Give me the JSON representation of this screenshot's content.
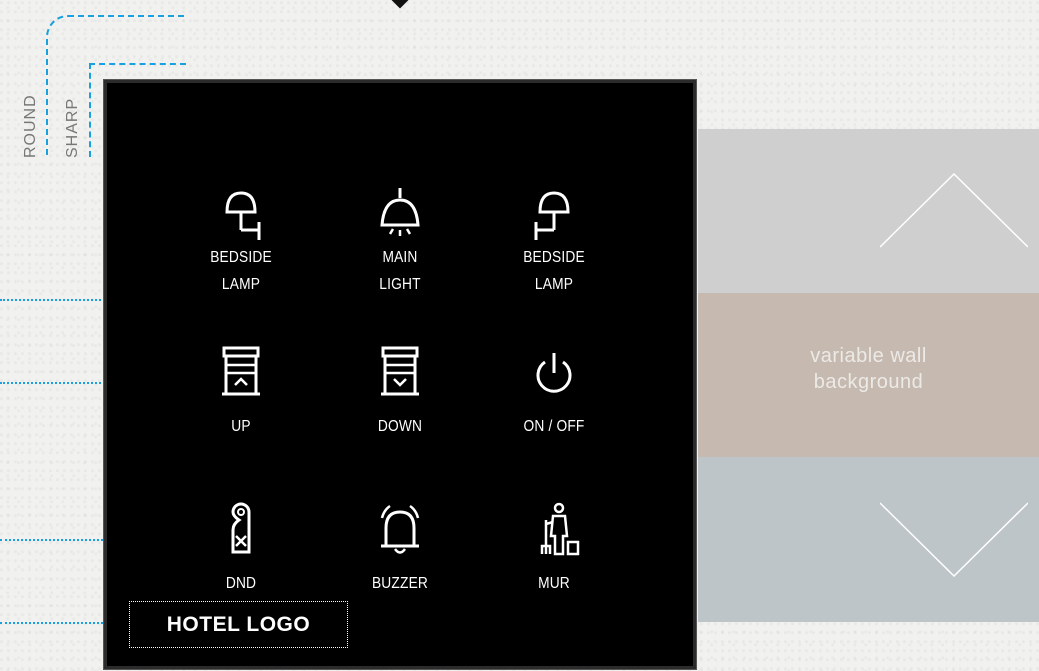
{
  "guides": {
    "round_label": "ROUND",
    "sharp_label": "SHARP"
  },
  "panel": {
    "buttons": [
      {
        "icon": "bedside-lamp-left-icon",
        "label_line1": "BEDSIDE",
        "label_line2": "LAMP"
      },
      {
        "icon": "ceiling-light-icon",
        "label_line1": "MAIN",
        "label_line2": "LIGHT"
      },
      {
        "icon": "bedside-lamp-right-icon",
        "label_line1": "BEDSIDE",
        "label_line2": "LAMP"
      },
      {
        "icon": "blinds-up-icon",
        "label_line1": "UP"
      },
      {
        "icon": "blinds-down-icon",
        "label_line1": "DOWN"
      },
      {
        "icon": "power-icon",
        "label_line1": "ON / OFF"
      },
      {
        "icon": "do-not-disturb-icon",
        "label_line1": "DND"
      },
      {
        "icon": "bell-icon",
        "label_line1": "BUZZER"
      },
      {
        "icon": "housekeeping-icon",
        "label_line1": "MUR"
      }
    ],
    "logo_text": "HOTEL LOGO"
  },
  "wall": {
    "text_line1": "variable wall",
    "text_line2": "background",
    "colors": [
      "#cfcfcf",
      "#c6b9b0",
      "#bec5c8"
    ]
  },
  "accent_color": "#1aa0de"
}
